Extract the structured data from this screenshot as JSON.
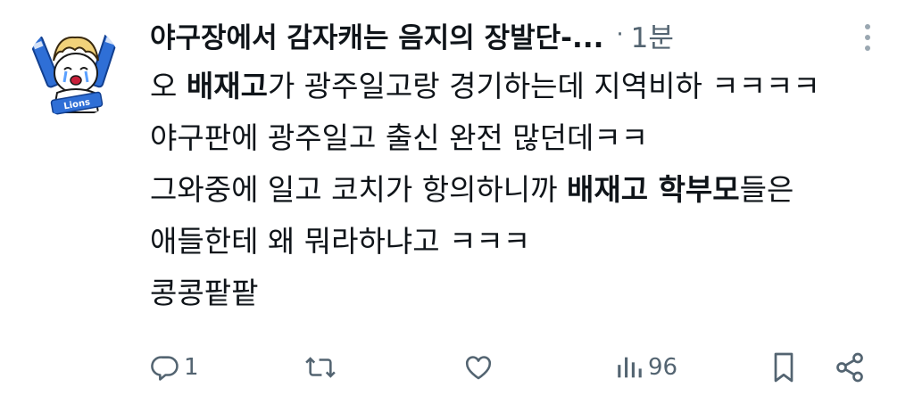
{
  "post": {
    "display_name": "야구장에서 감자캐는 음지의 장발단-...",
    "separator": "·",
    "time": "1분",
    "avatar_banner_text": "Lions",
    "body": {
      "line1": [
        "오 ",
        "배재고",
        "가 광주일고랑 경기하는데 지역비하 ㅋㅋㅋㅋ"
      ],
      "line2": "야구판에 광주일고 출신 완전 많던데ㅋㅋ",
      "line3": [
        "그와중에 일고 코치가 항의하니까 ",
        "배재고 학부모",
        "들은"
      ],
      "line4": "애들한테 왜 뭐라하냐고 ㅋㅋㅋ",
      "line5": "콩콩팥팥"
    }
  },
  "actions": {
    "reply_count": "1",
    "views_count": "96",
    "icons": [
      "reply-icon",
      "repost-icon",
      "like-icon",
      "views-icon",
      "bookmark-icon",
      "share-icon"
    ]
  },
  "colors": {
    "text": "#0f1419",
    "secondary": "#536471",
    "accent_blue": "#1d6fd8"
  }
}
